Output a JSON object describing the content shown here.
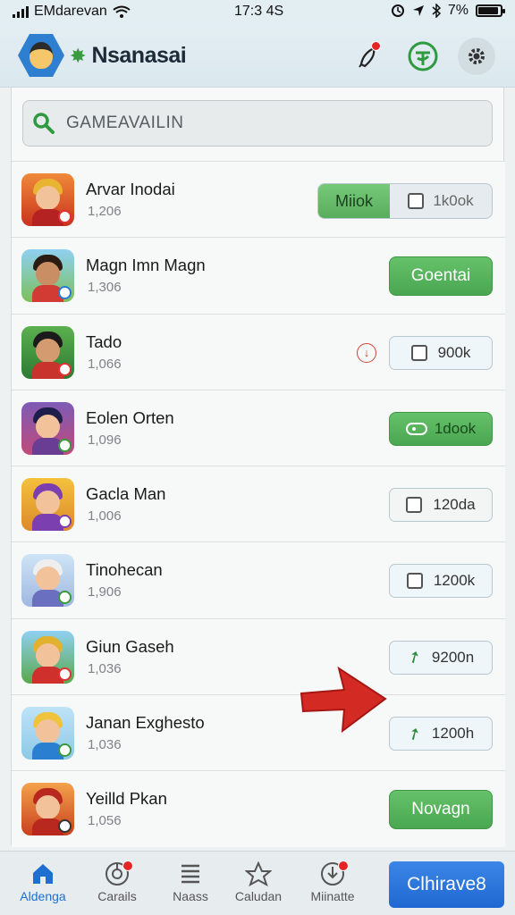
{
  "status_bar": {
    "carrier": "EMdarevan",
    "time": "17:3 4S",
    "battery": "7%"
  },
  "header": {
    "title": "Nsanasai",
    "colors": {
      "accent": "#2f7fd0",
      "green": "#4aa651"
    }
  },
  "search": {
    "placeholder": "GAMEAVAILIN"
  },
  "games": [
    {
      "name": "Arvar Inodai",
      "count": "1,206",
      "action": {
        "type": "segmented",
        "on_label": "Miiok",
        "off_label": "1k0ok"
      }
    },
    {
      "name": "Magn Imn Magn",
      "count": "1,306",
      "action": {
        "type": "green",
        "label": "Goentai"
      }
    },
    {
      "name": "Tado",
      "count": "1,066",
      "action": {
        "type": "outline",
        "label": "900k",
        "icon": "checkbox-icon"
      }
    },
    {
      "name": "Eolen Orten",
      "count": "1,096",
      "action": {
        "type": "green-small",
        "label": "1dook",
        "icon": "ticket-icon"
      }
    },
    {
      "name": "Gacla  Man",
      "count": "1,006",
      "action": {
        "type": "outline",
        "label": "120da",
        "icon": "checkbox-icon"
      }
    },
    {
      "name": "Tinohecan",
      "count": "1,906",
      "action": {
        "type": "outline",
        "label": "1200k",
        "icon": "checkbox-icon"
      }
    },
    {
      "name": "Giun Gaseh",
      "count": "1,036",
      "action": {
        "type": "outline",
        "label": "9200n",
        "icon": "leaf-icon"
      }
    },
    {
      "name": "Janan Exghesto",
      "count": "1,036",
      "action": {
        "type": "outline",
        "label": "1200h",
        "icon": "leaf-icon"
      }
    },
    {
      "name": "Yeilld Pkan",
      "count": "1,056",
      "action": {
        "type": "green",
        "label": "Novagn"
      }
    }
  ],
  "bottom_nav": {
    "items": [
      {
        "label": "Aldenga",
        "icon": "home-icon"
      },
      {
        "label": "Carails",
        "icon": "target-icon"
      },
      {
        "label": "Naass",
        "icon": "list-icon"
      },
      {
        "label": "Caludan",
        "icon": "star-icon"
      },
      {
        "label": "Miinatte",
        "icon": "download-icon"
      }
    ],
    "cta": "Clhirave8"
  }
}
